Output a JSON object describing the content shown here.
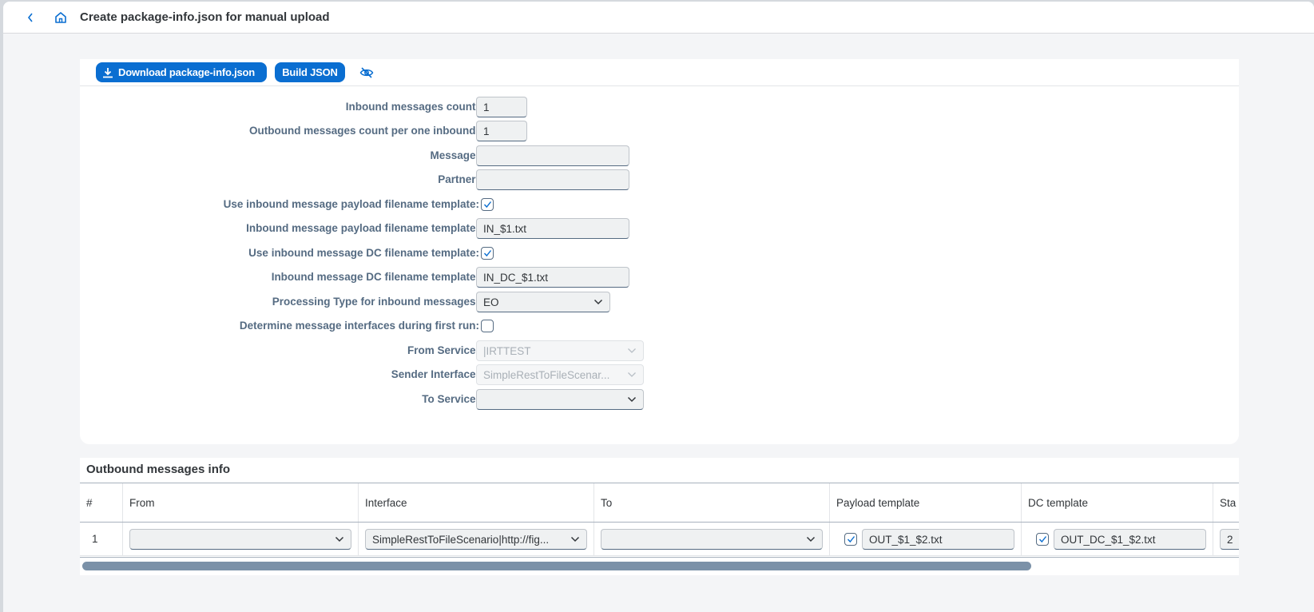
{
  "header": {
    "title": "Create package-info.json for manual upload",
    "back_icon": "chevron-left-icon",
    "home_icon": "home-icon"
  },
  "toolbar": {
    "download_label": "Download package-info.json",
    "download_icon": "download-icon",
    "build_label": "Build JSON",
    "hide_icon": "eye-slash-icon"
  },
  "form": {
    "inbound_count": {
      "label": "Inbound messages count:",
      "value": "1"
    },
    "outbound_count": {
      "label": "Outbound messages count per one inbound:",
      "value": "1"
    },
    "message": {
      "label": "Message:",
      "value": ""
    },
    "partner": {
      "label": "Partner:",
      "value": ""
    },
    "use_payload_template": {
      "label": "Use inbound message payload filename template:",
      "checked": true
    },
    "payload_template": {
      "label": "Inbound message payload filename template:",
      "value": "IN_$1.txt"
    },
    "use_dc_template": {
      "label": "Use inbound message DC filename template:",
      "checked": true
    },
    "dc_template": {
      "label": "Inbound message DC filename template:",
      "value": "IN_DC_$1.txt"
    },
    "processing_type": {
      "label": "Processing Type for inbound messages:",
      "value": "EO"
    },
    "determine_interfaces": {
      "label": "Determine message interfaces during first run:",
      "checked": false
    },
    "from_service": {
      "label": "From Service:",
      "value": "|IRTTEST",
      "disabled": true
    },
    "sender_interface": {
      "label": "Sender Interface:",
      "value": "SimpleRestToFileScenar...",
      "disabled": true
    },
    "to_service": {
      "label": "To Service:",
      "value": ""
    }
  },
  "outbound_table": {
    "title": "Outbound messages info",
    "columns": [
      "#",
      "From",
      "Interface",
      "To",
      "Payload template",
      "DC template",
      "Sta"
    ],
    "rows": [
      {
        "index": "1",
        "from": "",
        "interface": "SimpleRestToFileScenario|http://fig...",
        "to": "",
        "payload_checked": true,
        "payload_template": "OUT_$1_$2.txt",
        "dc_checked": true,
        "dc_template": "OUT_DC_$1_$2.txt",
        "status": "2"
      }
    ],
    "scroll_fraction_visible": 0.82
  },
  "colors": {
    "accent": "#0a6ed1",
    "label": "#556b82",
    "background": "#f4f5f7",
    "scrollbar": "#7b91a8"
  }
}
